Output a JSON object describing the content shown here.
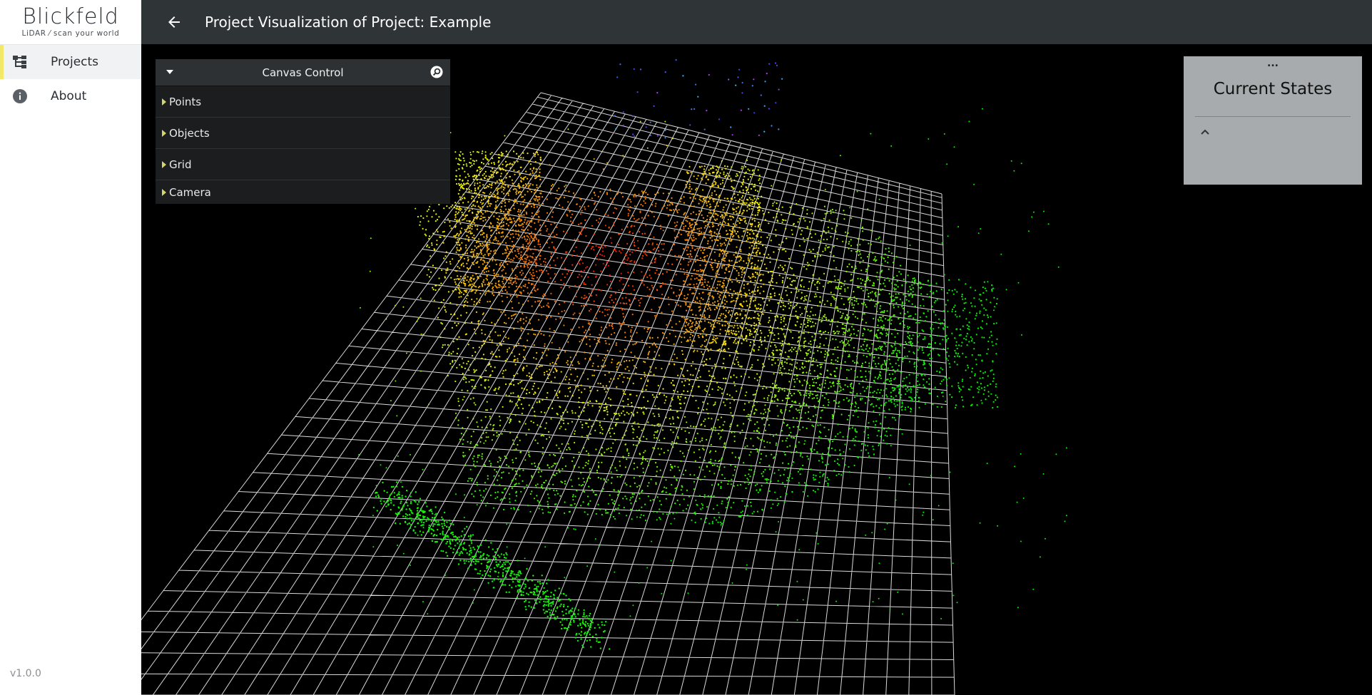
{
  "brand": {
    "logo_word": "Blickfeld",
    "logo_tagline": "LiDAR ⁄ scan your world"
  },
  "sidebar": {
    "items": [
      {
        "label": "Projects",
        "icon": "tree-structure-icon",
        "active": true
      },
      {
        "label": "About",
        "icon": "info-icon",
        "active": false
      }
    ],
    "version": "v1.0.0",
    "accent_color": "#f2e86a"
  },
  "header": {
    "title": "Project Visualization of Project: Example",
    "back_icon": "arrow-left-icon"
  },
  "canvas_control": {
    "title": "Canvas Control",
    "folders": [
      {
        "label": "Points"
      },
      {
        "label": "Objects"
      },
      {
        "label": "Grid"
      },
      {
        "label": "Camera"
      }
    ]
  },
  "current_states": {
    "handle": "...",
    "title": "Current States"
  },
  "colors": {
    "topbar": "#2f3437",
    "viewport": "#000000",
    "grid": "#ffffff",
    "panel_bg": "#1b1d1f",
    "states_bg": "#a7abad"
  }
}
